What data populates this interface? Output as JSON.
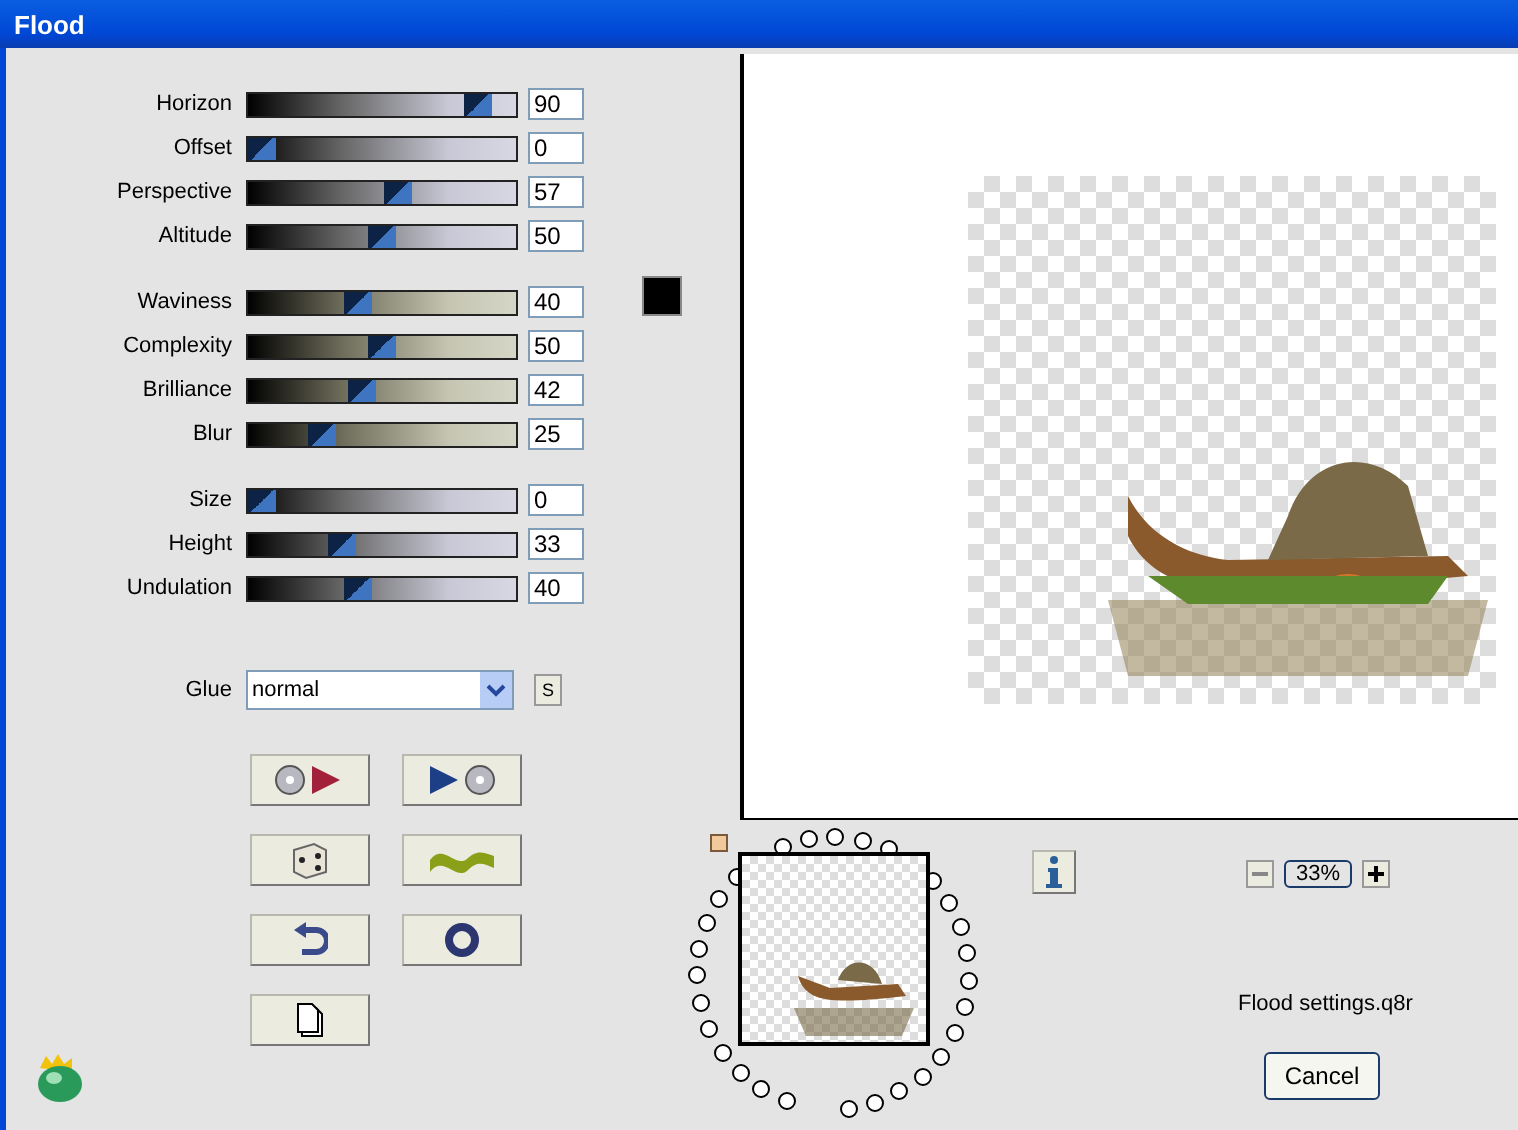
{
  "window": {
    "title": "Flood"
  },
  "slider_groups": [
    {
      "kind": "neutral",
      "sliders": [
        {
          "label": "Horizon",
          "value": "90",
          "level": 0.9
        },
        {
          "label": "Offset",
          "value": "0",
          "level": 0
        },
        {
          "label": "Perspective",
          "value": "57",
          "level": 0.57
        },
        {
          "label": "Altitude",
          "value": "50",
          "level": 0.5
        }
      ]
    },
    {
      "kind": "warm",
      "sliders": [
        {
          "label": "Waviness",
          "value": "40",
          "level": 0.4
        },
        {
          "label": "Complexity",
          "value": "50",
          "level": 0.5
        },
        {
          "label": "Brilliance",
          "value": "42",
          "level": 0.42
        },
        {
          "label": "Blur",
          "value": "25",
          "level": 0.25
        }
      ]
    },
    {
      "kind": "neutral",
      "sliders": [
        {
          "label": "Size",
          "value": "0",
          "level": 0
        },
        {
          "label": "Height",
          "value": "33",
          "level": 0.33
        },
        {
          "label": "Undulation",
          "value": "40",
          "level": 0.4
        }
      ]
    }
  ],
  "glue": {
    "label": "Glue",
    "value": "normal",
    "side_button": "S"
  },
  "zoom": {
    "value": "33%"
  },
  "settings_file": "Flood settings.q8r",
  "cancel_button": "Cancel"
}
